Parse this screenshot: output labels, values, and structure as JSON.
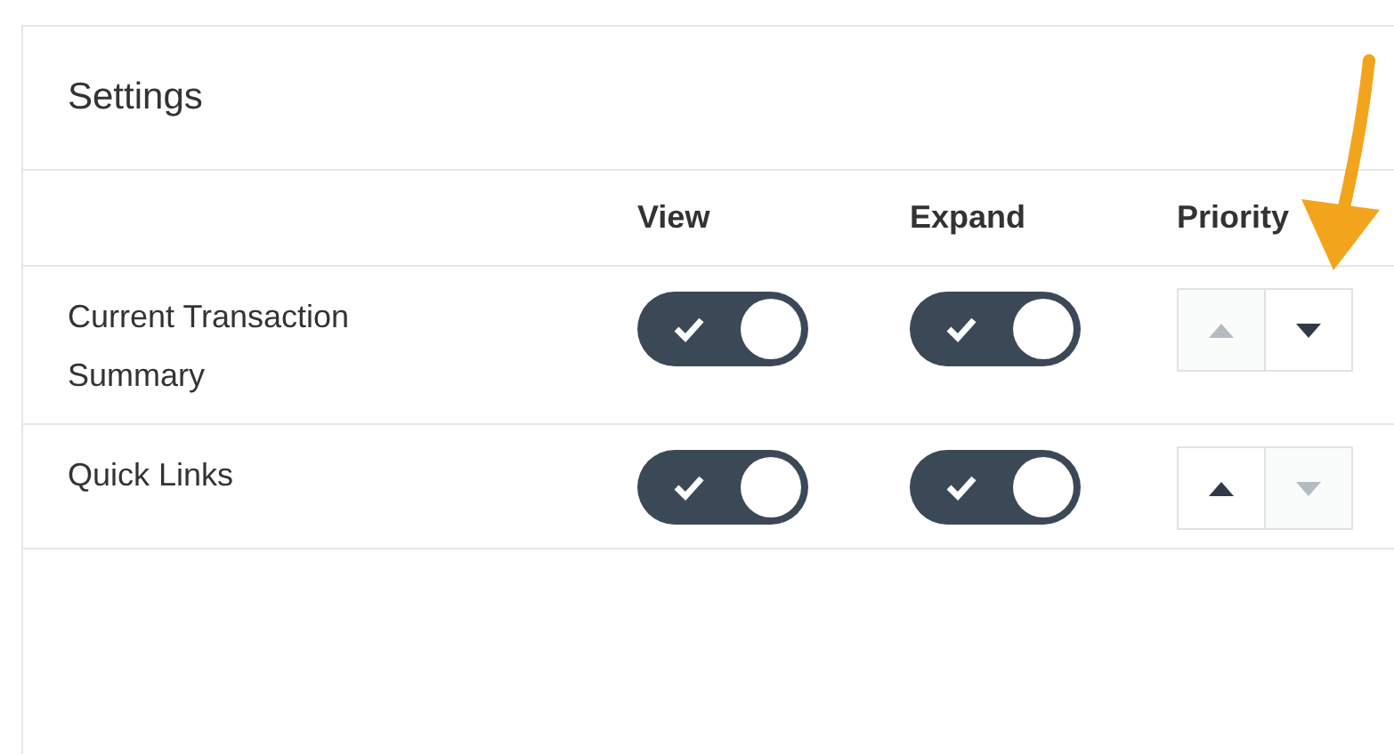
{
  "panel": {
    "title": "Settings"
  },
  "columns": [
    "View",
    "Expand",
    "Priority"
  ],
  "rows": [
    {
      "label": "Current Transaction Summary",
      "view": {
        "on": true
      },
      "expand": {
        "on": true
      },
      "priority": {
        "up_disabled": true,
        "down_disabled": false
      }
    },
    {
      "label": "Quick Links",
      "view": {
        "on": true
      },
      "expand": {
        "on": true
      },
      "priority": {
        "up_disabled": false,
        "down_disabled": true
      }
    }
  ]
}
